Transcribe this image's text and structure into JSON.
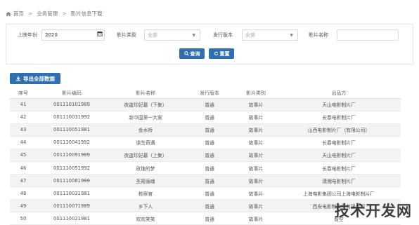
{
  "breadcrumb": {
    "items": [
      "首页",
      "业务管理",
      "影片信息下载"
    ]
  },
  "filters": {
    "year_label": "上映年份",
    "year_value": "2020",
    "type_label": "影片类型",
    "type_value": "全部",
    "version_label": "发行版本",
    "version_value": "全部",
    "name_label": "影片名称",
    "name_value": ""
  },
  "buttons": {
    "search": "查询",
    "reset": "重置",
    "export": "导出全部数据"
  },
  "table": {
    "headers": [
      "序号",
      "影片编码",
      "影片名称",
      "发行版本",
      "影片类别",
      "出品方"
    ],
    "rows": [
      [
        "41",
        "001110101989",
        "夜盗珍妃墓（下集）",
        "普通",
        "故事片",
        "天山电影制片厂"
      ],
      [
        "42",
        "001110031992",
        "新中国第一大案",
        "普通",
        "故事片",
        "长春电影制片厂"
      ],
      [
        "43",
        "001110051981",
        "金水桥",
        "普通",
        "故事片",
        "山西电影制片厂（有限公司）"
      ],
      [
        "44",
        "001110041992",
        "谍生奇遇",
        "普通",
        "故事片",
        "长春电影制片厂"
      ],
      [
        "45",
        "001110091989",
        "夜盗珍妃墓（上集）",
        "普通",
        "故事片",
        "天山电影制片厂"
      ],
      [
        "46",
        "001110051992",
        "玫瑰的梦",
        "普通",
        "故事片",
        "长春电影制片厂"
      ],
      [
        "47",
        "001110081989",
        "圣殿骊魂",
        "普通",
        "故事片",
        "潇湘电影制片厂"
      ],
      [
        "48",
        "001110031981",
        "枪察官",
        "普通",
        "故事片",
        "上海电影集团公司上海电影制片厂"
      ],
      [
        "49",
        "001110071989",
        "乡下人",
        "普通",
        "故事片",
        "西安电影制片厂有限公司"
      ],
      [
        "50",
        "001110021981",
        "欢欢笑笑",
        "普通",
        "故事片",
        "智空"
      ]
    ]
  },
  "watermark": "技术开发网",
  "colors": {
    "primary": "#2f6fb0",
    "row_stripe": "#f3f3f3"
  }
}
